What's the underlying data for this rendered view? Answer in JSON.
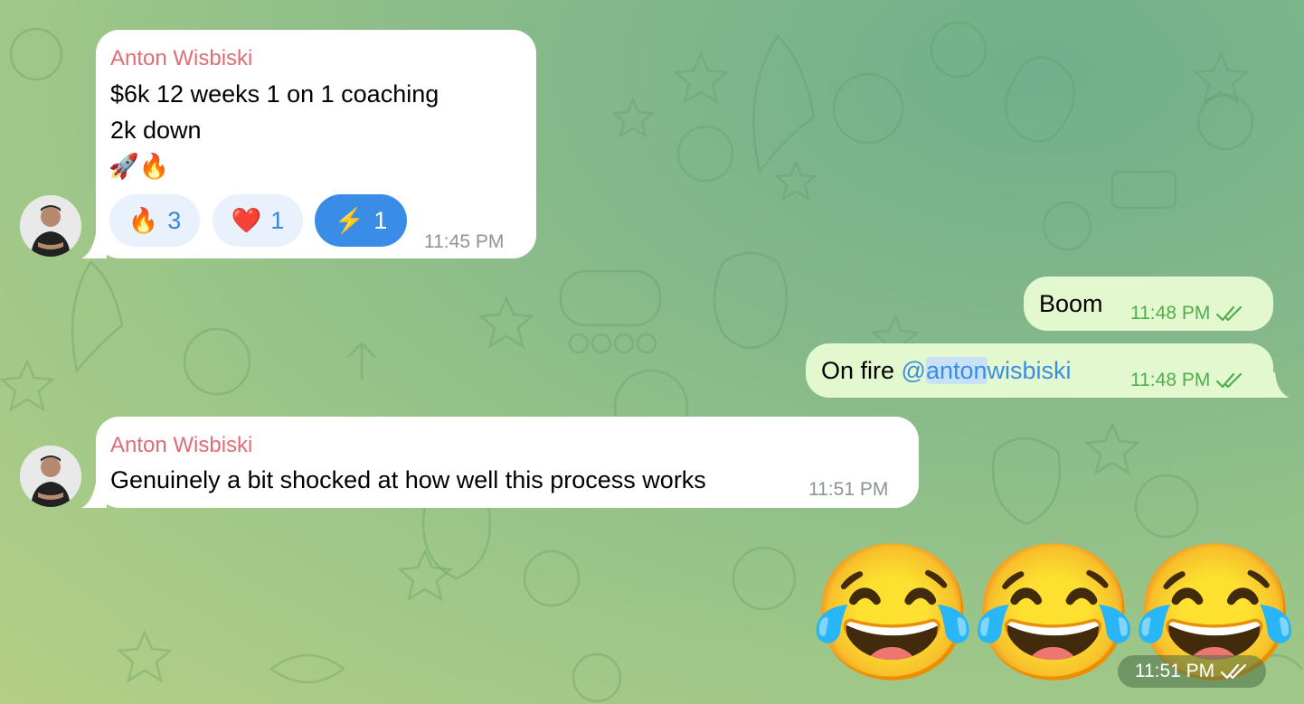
{
  "chat": {
    "messages": [
      {
        "sender": "Anton Wisbiski",
        "lines": [
          "$6k 12 weeks 1 on 1 coaching",
          "2k down",
          "🚀🔥"
        ],
        "reactions": [
          {
            "emoji": "🔥",
            "count": "3"
          },
          {
            "emoji": "❤️",
            "count": "1"
          },
          {
            "emoji": "⚡",
            "count": "1"
          }
        ],
        "time": "11:45 PM"
      },
      {
        "text": "Boom",
        "time": "11:48 PM"
      },
      {
        "text_prefix": "On fire ",
        "mention_at": "@",
        "mention_highlight": "anton",
        "mention_rest": "wisbiski",
        "time": "11:48 PM"
      },
      {
        "sender": "Anton Wisbiski",
        "text": "Genuinely a bit shocked at how well this process works",
        "time": "11:51 PM"
      },
      {
        "emoji": "😂😂😂",
        "time": "11:51 PM"
      }
    ]
  },
  "icons": {
    "read_status": "double-check-icon",
    "avatar": "user-avatar"
  },
  "colors": {
    "sender_name": "#e06d74",
    "outgoing_bubble": "#e3f8cf",
    "outgoing_time": "#4fae4e",
    "mention": "#3a8de6",
    "reaction_selected": "#3a8de6"
  }
}
